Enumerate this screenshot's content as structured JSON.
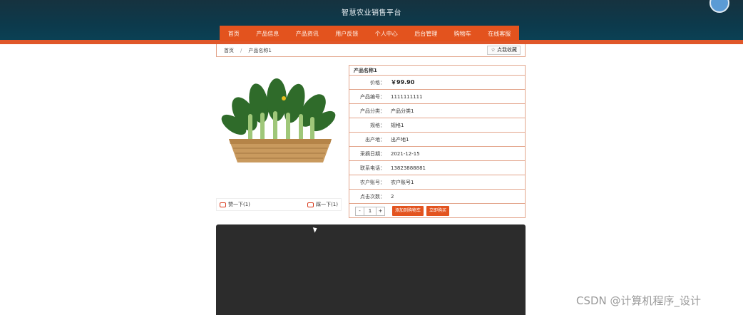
{
  "site": {
    "title": "智慧农业销售平台"
  },
  "nav": {
    "items": [
      "首页",
      "产品信息",
      "产品资讯",
      "用户反馈",
      "个人中心",
      "后台管理",
      "购物车",
      "在线客服"
    ]
  },
  "breadcrumb": {
    "home": "首页",
    "sep": "/",
    "current": "产品名称1",
    "favorite_label": "☆ 点我收藏"
  },
  "product": {
    "name": "产品名称1",
    "rows": [
      {
        "label": "价格：",
        "value": "￥99.90"
      },
      {
        "label": "产品编号：",
        "value": "1111111111"
      },
      {
        "label": "产品分类：",
        "value": "产品分类1"
      },
      {
        "label": "规格：",
        "value": "规格1"
      },
      {
        "label": "出产地：",
        "value": "出产地1"
      },
      {
        "label": "采摘日期：",
        "value": "2021-12-15"
      },
      {
        "label": "联系电话：",
        "value": "13823888881"
      },
      {
        "label": "农户账号：",
        "value": "农户账号1"
      },
      {
        "label": "点击次数：",
        "value": "2"
      }
    ],
    "qty": {
      "minus": "-",
      "value": "1",
      "plus": "+"
    },
    "add_cart_label": "添加到购物车",
    "buy_label": "立即购买"
  },
  "votes": {
    "up": "赞一下(1)",
    "down": "踩一下(1)"
  },
  "watermark": "CSDN @计算机程序_设计",
  "colors": {
    "accent": "#e3531e",
    "header": "#0c3a4c",
    "border": "#e3a58c"
  }
}
